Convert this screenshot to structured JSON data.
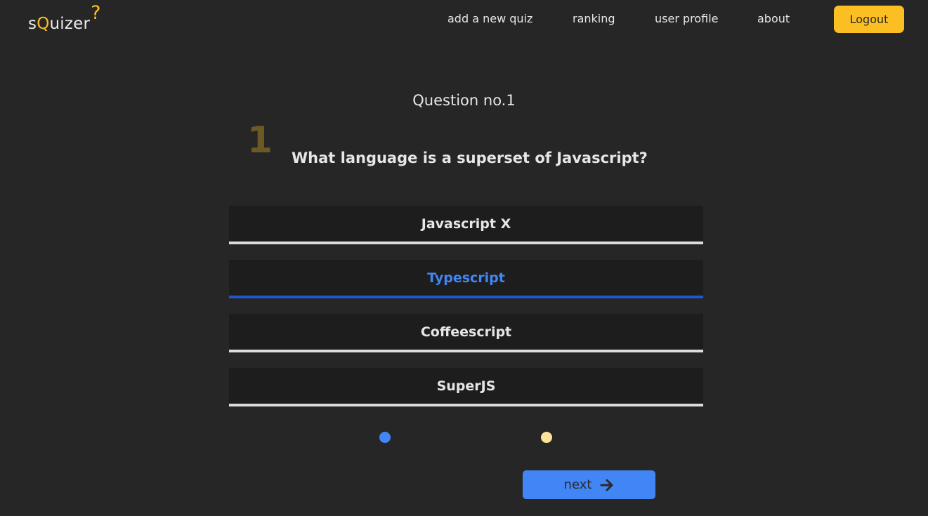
{
  "app": {
    "logo_prefix": "s",
    "logo_q": "Q",
    "logo_suffix": "uizer",
    "logo_mark": "?"
  },
  "nav": {
    "add_quiz": "add a new quiz",
    "ranking": "ranking",
    "user_profile": "user profile",
    "about": "about",
    "logout": "Logout"
  },
  "quiz": {
    "question_title": "Question no.1",
    "question_number": "1",
    "question_text": "What language is a superset of Javascript?",
    "answers": [
      {
        "label": "Javascript X",
        "selected": false
      },
      {
        "label": "Typescript",
        "selected": true
      },
      {
        "label": "Coffeescript",
        "selected": false
      },
      {
        "label": "SuperJS",
        "selected": false
      }
    ],
    "next_label": "next",
    "next_icon": "arrow-right-icon"
  },
  "colors": {
    "background": "#262626",
    "accent_yellow": "#fbbf24",
    "accent_blue": "#4285f4",
    "selected_underline": "#1e56d0",
    "dot_active": "#4285f4",
    "dot_inactive": "#fde39a"
  }
}
